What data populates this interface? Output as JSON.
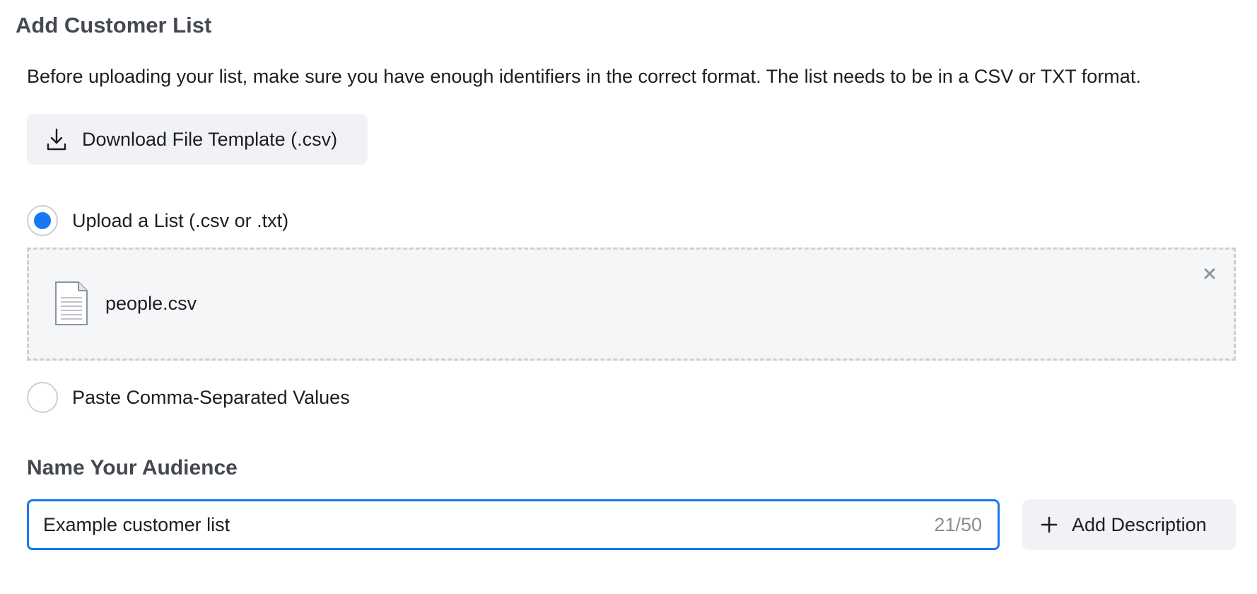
{
  "header": {
    "title": "Add Customer List",
    "intro": "Before uploading your list, make sure you have enough identifiers in the correct format. The list needs to be in a CSV or TXT format."
  },
  "download": {
    "label": "Download File Template (.csv)",
    "icon": "download-icon"
  },
  "options": {
    "upload": {
      "label": "Upload a List (.csv or .txt)",
      "selected": true
    },
    "paste": {
      "label": "Paste Comma-Separated Values",
      "selected": false
    }
  },
  "upload_file": {
    "file_name": "people.csv",
    "icon": "file-icon",
    "remove_icon": "close-icon"
  },
  "audience": {
    "heading": "Name Your Audience",
    "name_value": "Example customer list",
    "char_count": "21/50",
    "add_description_label": "Add Description"
  },
  "colors": {
    "accent": "#1877f2",
    "button_bg": "#f0f2f5",
    "dropzone_bg": "#f5f6f7"
  }
}
